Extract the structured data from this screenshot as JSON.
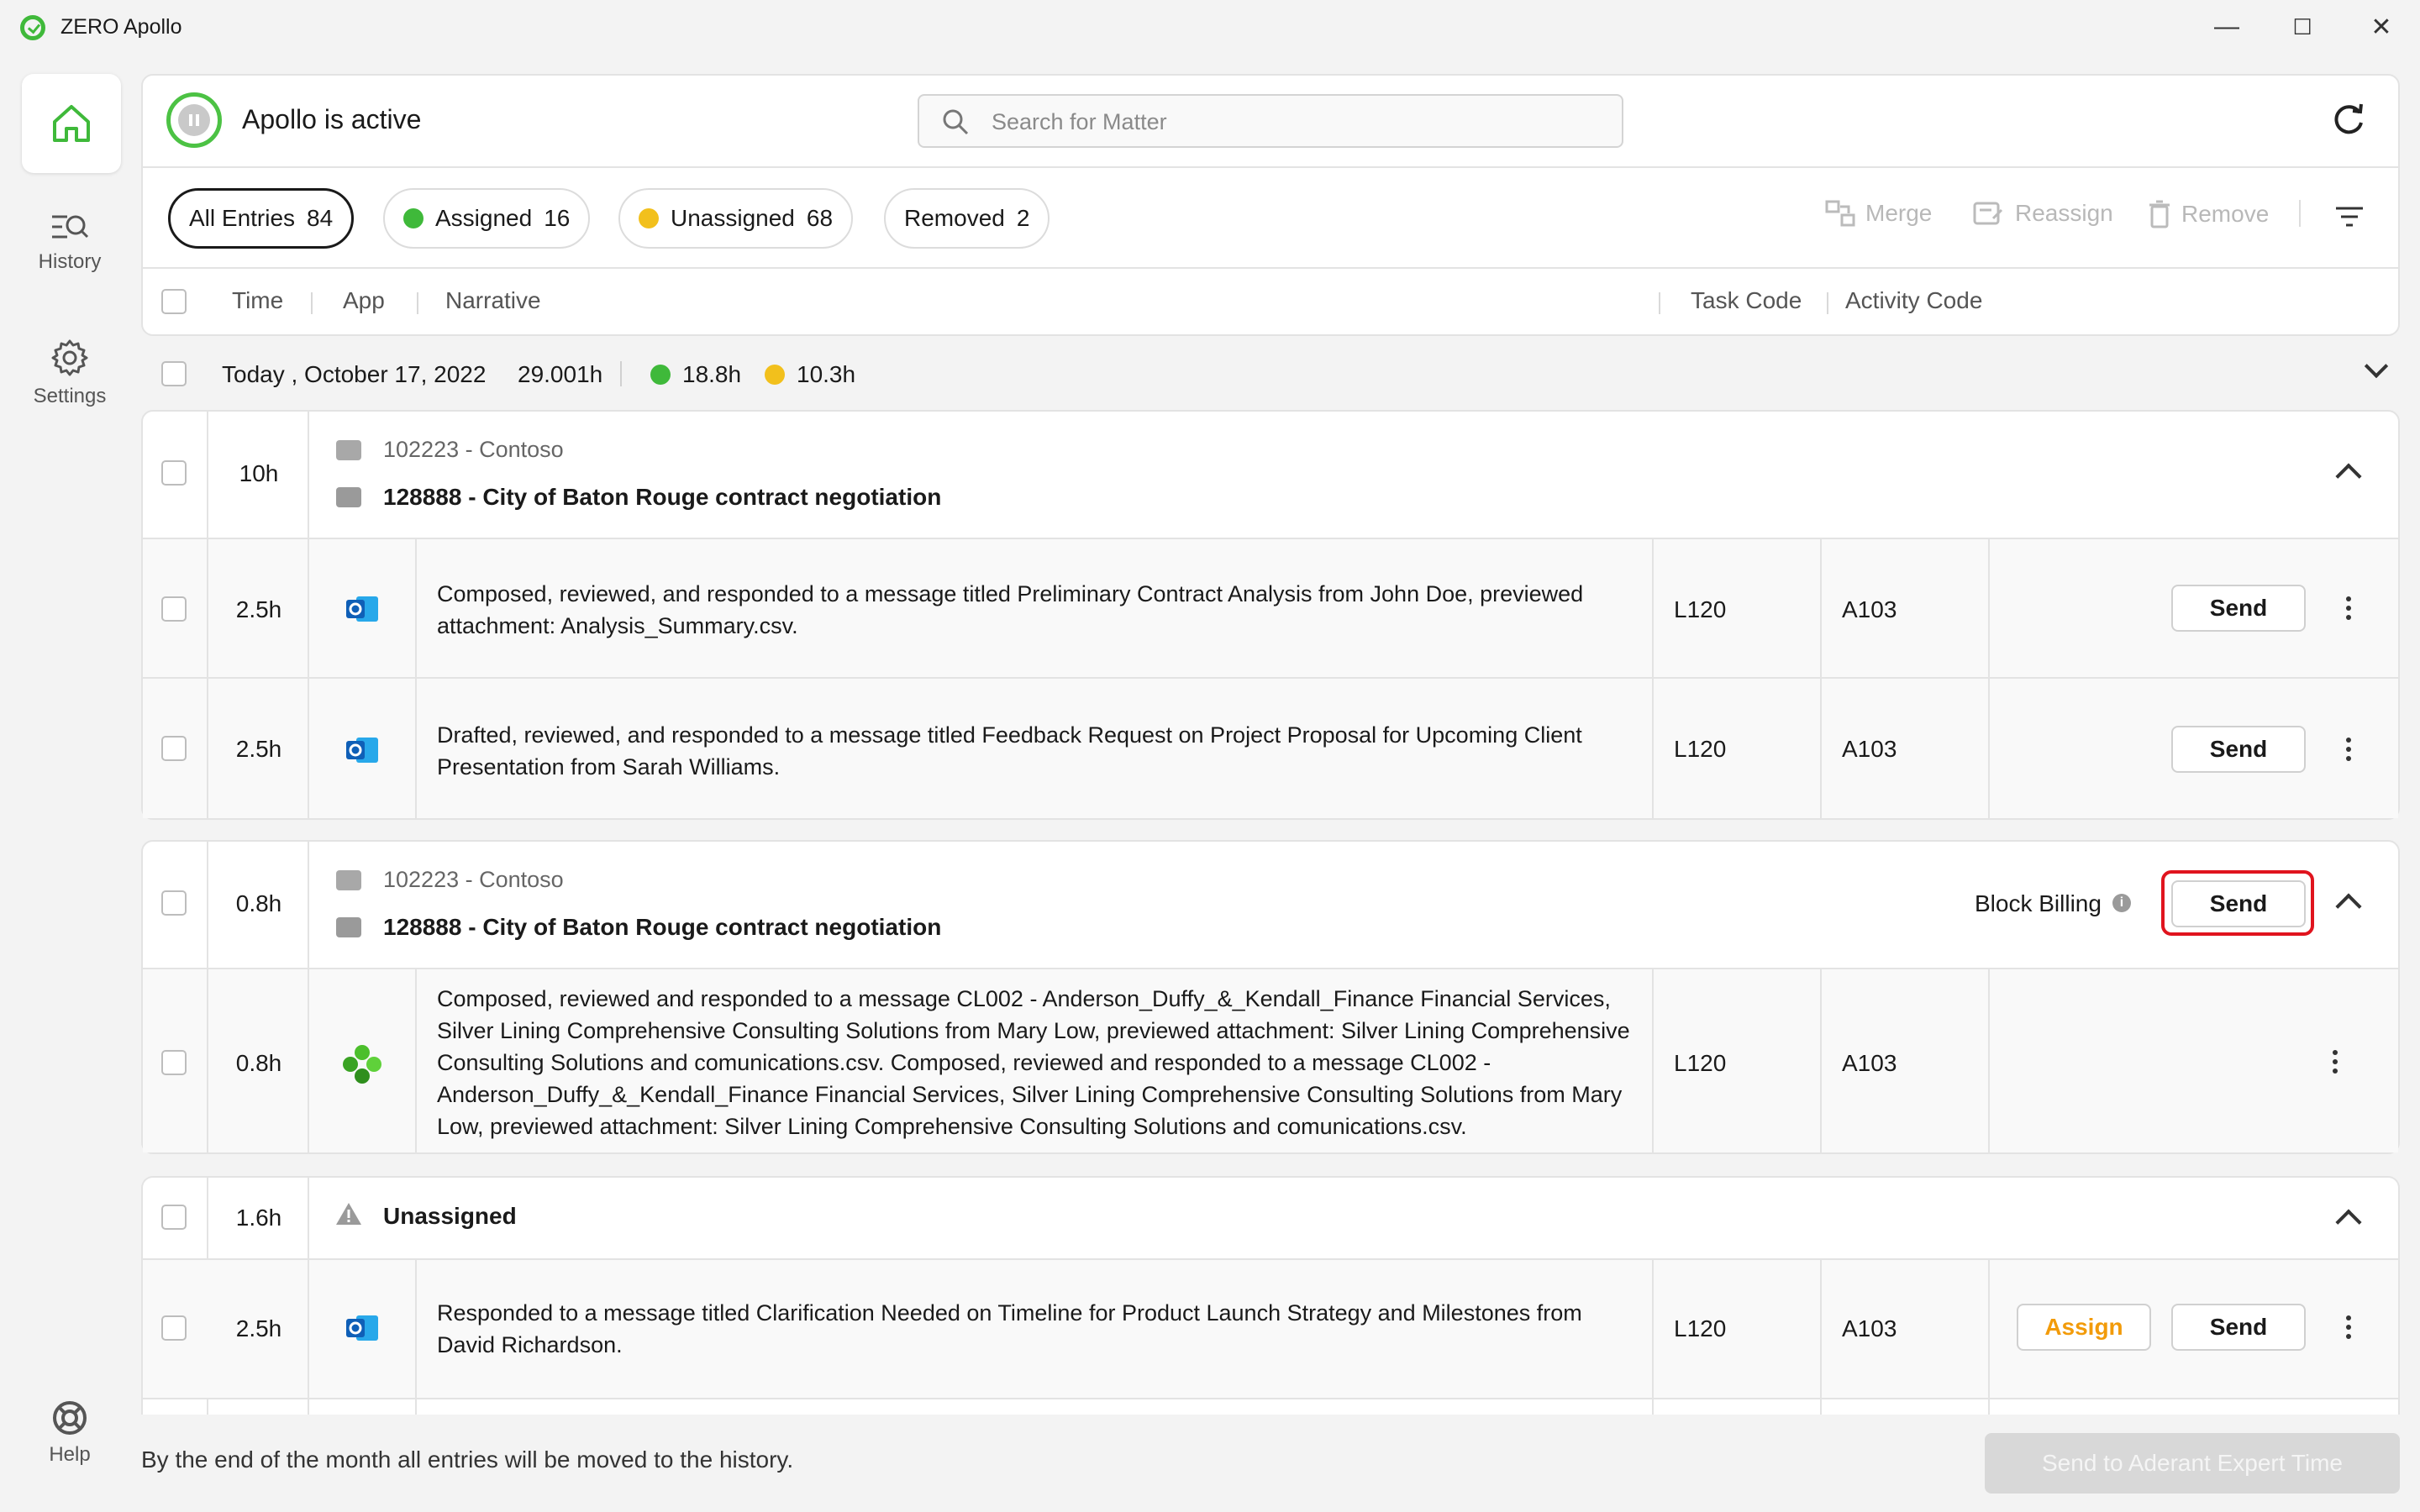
{
  "window": {
    "title": "ZERO Apollo",
    "minimize": "—",
    "maximize": "☐",
    "close": "✕"
  },
  "sidebar": {
    "items": [
      {
        "label": "History"
      },
      {
        "label": "Settings"
      },
      {
        "label": "Help"
      }
    ]
  },
  "header": {
    "status": "Apollo is active",
    "search_placeholder": "Search for Matter"
  },
  "filters": {
    "all": {
      "label": "All Entries",
      "count": "84"
    },
    "assigned": {
      "label": "Assigned",
      "count": "16"
    },
    "unassigned": {
      "label": "Unassigned",
      "count": "68"
    },
    "removed": {
      "label": "Removed",
      "count": "2"
    }
  },
  "toolbar": {
    "merge": "Merge",
    "reassign": "Reassign",
    "remove": "Remove"
  },
  "columns": {
    "time": "Time",
    "app": "App",
    "narrative": "Narrative",
    "task_code": "Task Code",
    "activity_code": "Activity Code"
  },
  "day": {
    "label": "Today , October 17, 2022",
    "total": "29.001h",
    "assigned": "18.8h",
    "unassigned": "10.3h"
  },
  "groups": [
    {
      "time": "10h",
      "client": "102223 - Contoso",
      "matter": "128888 - City of Baton Rouge contract negotiation",
      "entries": [
        {
          "time": "2.5h",
          "app": "outlook-icon",
          "narrative": "Composed, reviewed, and responded to a message titled Preliminary Contract Analysis from John Doe, previewed attachment: Analysis_Summary.csv.",
          "task": "L120",
          "activity": "A103",
          "send": "Send"
        },
        {
          "time": "2.5h",
          "app": "outlook-icon",
          "narrative": "Drafted, reviewed, and responded to a message titled Feedback Request on Project Proposal for Upcoming Client Presentation from Sarah Williams.",
          "task": "L120",
          "activity": "A103",
          "send": "Send"
        }
      ]
    },
    {
      "time": "0.8h",
      "client": "102223 - Contoso",
      "matter": "128888 - City of Baton Rouge contract negotiation",
      "block_billing": "Block Billing",
      "send": "Send",
      "entries": [
        {
          "time": "0.8h",
          "app": "clover-icon",
          "narrative": "Composed, reviewed and responded to a message CL002 - Anderson_Duffy_&_Kendall_Finance Financial Services, Silver Lining Comprehensive Consulting Solutions from Mary Low, previewed attachment: Silver Lining Comprehensive Consulting Solutions and comunications.csv. Composed, reviewed and responded to a message CL002 - Anderson_Duffy_&_Kendall_Finance Financial Services, Silver Lining Comprehensive Consulting Solutions from Mary Low, previewed attachment: Silver Lining Comprehensive Consulting Solutions and comunications.csv.",
          "task": "L120",
          "activity": "A103"
        }
      ]
    },
    {
      "time": "1.6h",
      "title": "Unassigned",
      "entries": [
        {
          "time": "2.5h",
          "app": "outlook-icon",
          "narrative": "Responded to a message titled Clarification Needed on Timeline for Product Launch Strategy and Milestones from David Richardson.",
          "task": "L120",
          "activity": "A103",
          "assign": "Assign",
          "send": "Send"
        }
      ]
    }
  ],
  "footer": {
    "note": "By the end of the month all entries will be moved to the history.",
    "button": "Send to Aderant Expert Time"
  },
  "colors": {
    "accent_green": "#3fb93a",
    "accent_yellow": "#f2c01c",
    "assign_orange": "#f29b0a",
    "highlight_red": "#e0141e"
  }
}
